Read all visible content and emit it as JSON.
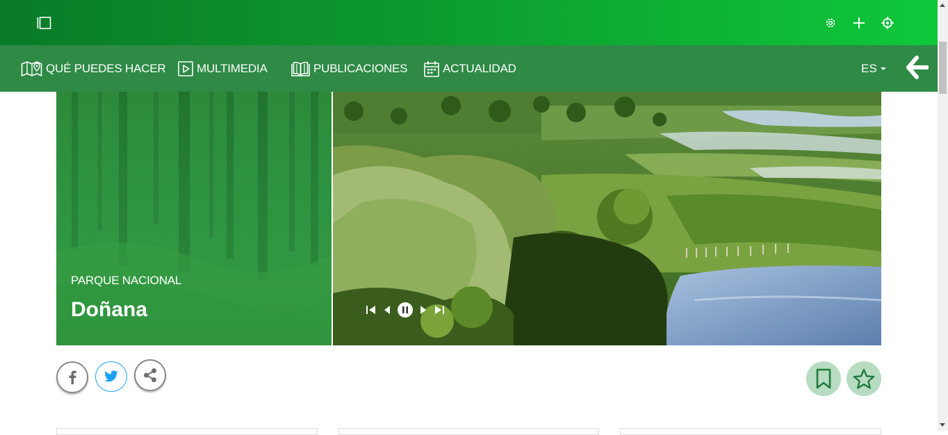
{
  "topbar": {
    "icons": [
      "sidebar-toggle-icon",
      "gear-icon",
      "plus-icon",
      "crosshair-icon"
    ]
  },
  "nav": {
    "items": [
      {
        "label": "QUÉ PUEDES HACER",
        "icon": "map-pin-icon"
      },
      {
        "label": "MULTIMEDIA",
        "icon": "play-icon"
      },
      {
        "label": "PUBLICACIONES",
        "icon": "book-icon"
      },
      {
        "label": "ACTUALIDAD",
        "icon": "calendar-icon"
      }
    ],
    "language": "ES",
    "back_icon": "arrow-left-icon"
  },
  "hero": {
    "kicker": "PARQUE NACIONAL",
    "title": "Doñana",
    "controls": [
      "first-icon",
      "prev-icon",
      "pause-icon",
      "next-icon",
      "last-icon"
    ]
  },
  "share": {
    "buttons": [
      "facebook-icon",
      "twitter-icon",
      "share-icon"
    ]
  },
  "actions": {
    "buttons": [
      "bookmark-icon",
      "star-icon"
    ]
  },
  "colors": {
    "topbar_start": "#0a7a28",
    "topbar_end": "#0fc83a",
    "navbar": "#2e8a45",
    "action_bg": "#b7dcc1",
    "action_fg": "#1f7a3a",
    "twitter": "#1da1f2"
  }
}
